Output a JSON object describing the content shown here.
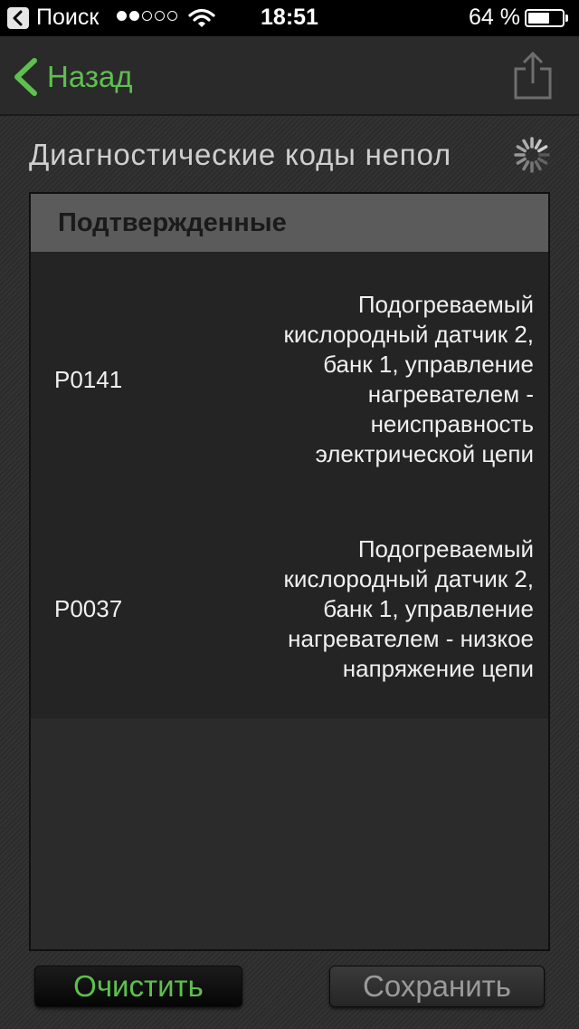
{
  "status_bar": {
    "back_label": "Поиск",
    "signal_bars_total": 5,
    "signal_bars_filled": 2,
    "time": "18:51",
    "battery_percent_label": "64 %",
    "battery_level": 0.64
  },
  "nav": {
    "back_label": "Назад"
  },
  "page": {
    "title": "Диагностические коды непол"
  },
  "codes": {
    "section_title": "Подтвержденные",
    "items": [
      {
        "code": "P0141",
        "description": "Подогреваемый кислородный датчик 2, банк 1, управление нагревателем - неисправность электрической цепи"
      },
      {
        "code": "P0037",
        "description": "Подогреваемый кислородный датчик 2, банк 1, управление нагревателем - низкое напряжение цепи"
      }
    ]
  },
  "actions": {
    "clear_label": "Очистить",
    "save_label": "Сохранить"
  },
  "colors": {
    "accent": "#5ec04f",
    "section_header_bg": "#5b5b5b"
  }
}
